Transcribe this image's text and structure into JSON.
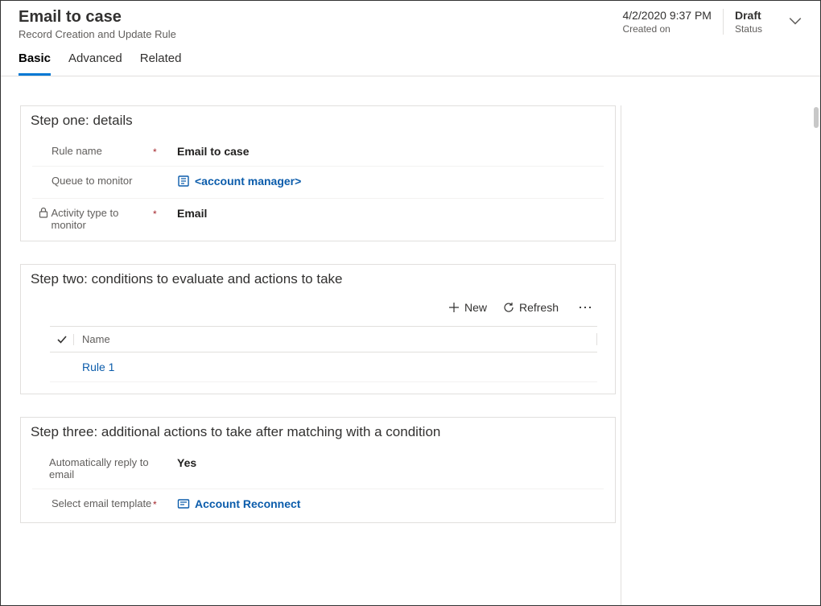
{
  "header": {
    "title": "Email to case",
    "subtitle": "Record Creation and Update Rule",
    "meta": {
      "created_value": "4/2/2020 9:37 PM",
      "created_label": "Created on",
      "status_value": "Draft",
      "status_label": "Status"
    }
  },
  "tabs": {
    "basic": "Basic",
    "advanced": "Advanced",
    "related": "Related"
  },
  "step_one": {
    "title": "Step one: details",
    "rule_name": {
      "label": "Rule name",
      "value": "Email to case"
    },
    "queue": {
      "label": "Queue to monitor",
      "value": "<account manager>"
    },
    "activity_type": {
      "label": "Activity type to monitor",
      "value": "Email"
    }
  },
  "step_two": {
    "title": "Step two: conditions to evaluate and actions to take",
    "commands": {
      "new": "New",
      "refresh": "Refresh"
    },
    "columns": {
      "name": "Name"
    },
    "rows": [
      {
        "name": "Rule 1"
      }
    ]
  },
  "step_three": {
    "title": "Step three: additional actions to take after matching with a condition",
    "auto_reply": {
      "label": "Automatically reply to email",
      "value": "Yes"
    },
    "template": {
      "label": "Select email template",
      "value": "Account Reconnect"
    }
  }
}
